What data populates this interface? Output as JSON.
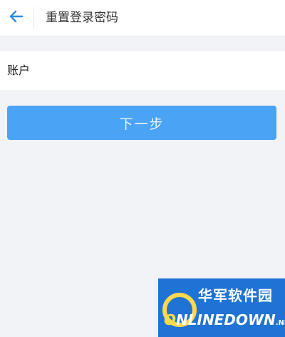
{
  "header": {
    "back_icon": "back-arrow-icon",
    "title": "重置登录密码"
  },
  "form": {
    "account_label": "账户",
    "account_value": "",
    "account_placeholder": ""
  },
  "actions": {
    "next_label": "下一步"
  },
  "watermark": {
    "brand_cn": "华军软件园",
    "brand_en_first": "O",
    "brand_en_rest": "NLINEDOWN",
    "brand_en_suffix": ".NET"
  },
  "colors": {
    "accent": "#4aa3f5",
    "background": "#f2f3f7",
    "back_arrow": "#2a8de6"
  }
}
